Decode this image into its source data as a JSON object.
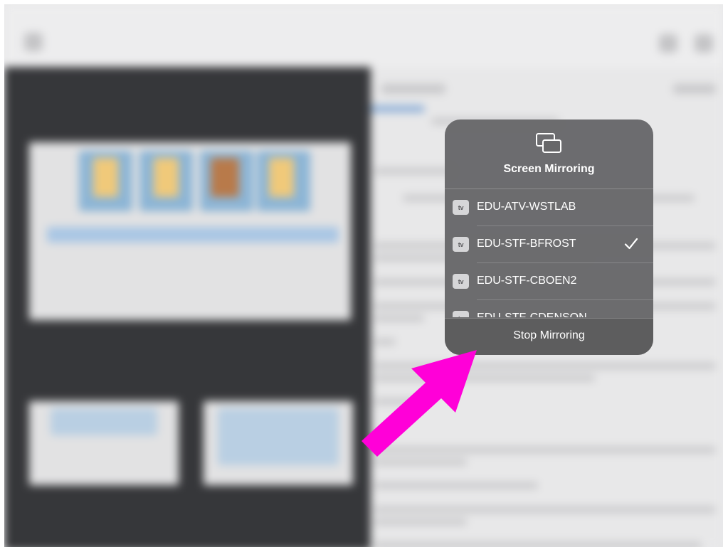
{
  "popover": {
    "title": "Screen Mirroring",
    "icon": "screen-mirroring-icon",
    "devices": [
      {
        "badge": "tv",
        "name": "EDU-ATV-WSTLAB",
        "selected": false
      },
      {
        "badge": "tv",
        "name": "EDU-STF-BFROST",
        "selected": true
      },
      {
        "badge": "tv",
        "name": "EDU-STF-CBOEN2",
        "selected": false
      },
      {
        "badge": "tv",
        "name": "EDU-STF-CDENSON",
        "selected": false
      }
    ],
    "stop_label": "Stop Mirroring"
  },
  "annotation": {
    "arrow_color": "#ff00d8"
  },
  "colors": {
    "popover_bg": "#676769",
    "dark_pane": "#36373a",
    "background": "#e9e9ea"
  }
}
